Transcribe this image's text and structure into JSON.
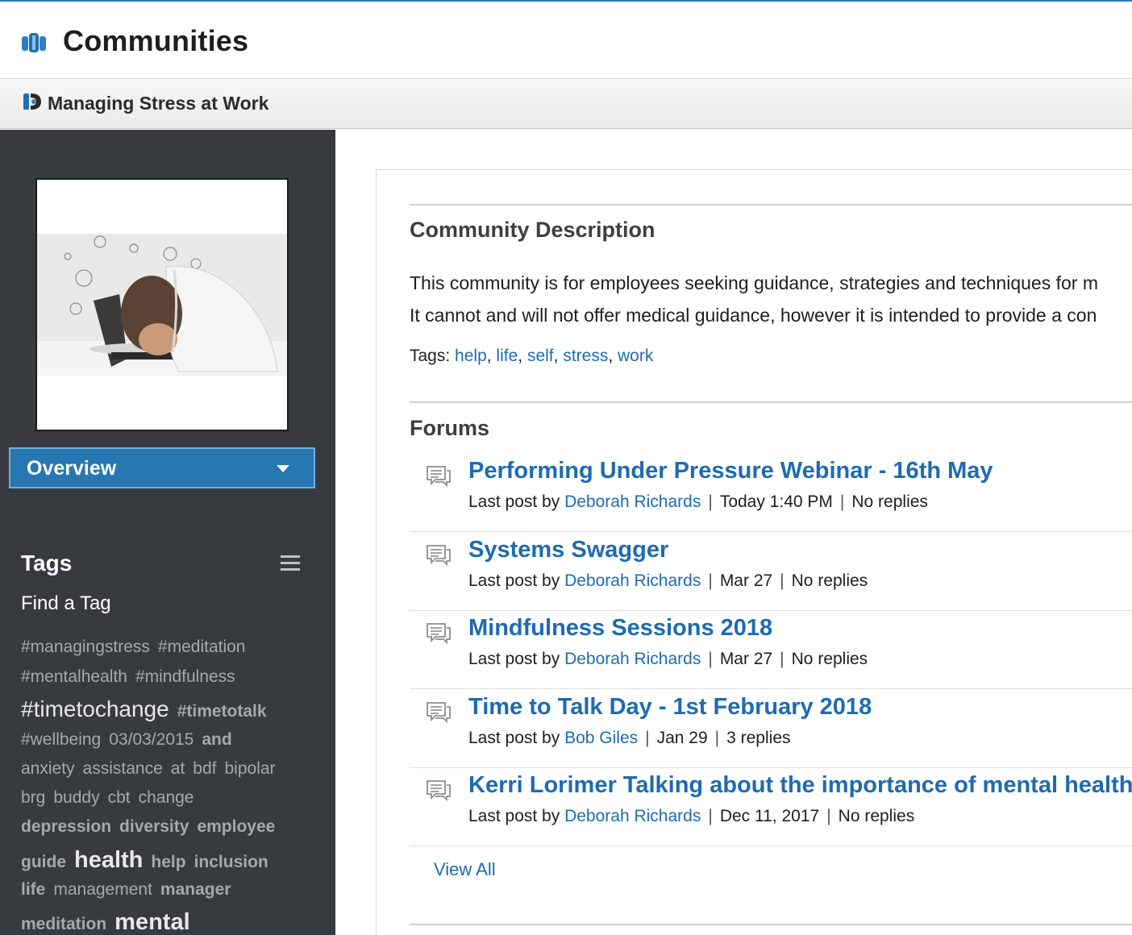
{
  "header": {
    "app_title": "Communities"
  },
  "community": {
    "name": "Managing Stress at Work"
  },
  "sidebar": {
    "nav_selected": "Overview",
    "tags_heading": "Tags",
    "find_tag": "Find a Tag",
    "tag_lines": [
      [
        {
          "t": "#managingstress",
          "s": "sm"
        },
        {
          "t": "#meditation",
          "s": "sm"
        }
      ],
      [
        {
          "t": "#mentalhealth",
          "s": "sm"
        },
        {
          "t": "#mindfulness",
          "s": "sm"
        }
      ],
      [
        {
          "t": "#timetochange",
          "s": "lg"
        },
        {
          "t": "#timetotalk",
          "s": "md"
        }
      ],
      [
        {
          "t": "#wellbeing",
          "s": "sm"
        },
        {
          "t": "03/03/2015",
          "s": "sm"
        },
        {
          "t": "and",
          "s": "md"
        }
      ],
      [
        {
          "t": "anxiety",
          "s": "sm"
        },
        {
          "t": "assistance",
          "s": "sm"
        },
        {
          "t": "at",
          "s": "sm"
        },
        {
          "t": "bdf",
          "s": "sm"
        },
        {
          "t": "bipolar",
          "s": "sm"
        }
      ],
      [
        {
          "t": "brg",
          "s": "sm"
        },
        {
          "t": "buddy",
          "s": "sm"
        },
        {
          "t": "cbt",
          "s": "sm"
        },
        {
          "t": "change",
          "s": "sm"
        }
      ],
      [
        {
          "t": "depression",
          "s": "md"
        },
        {
          "t": "diversity",
          "s": "md"
        },
        {
          "t": "employee",
          "s": "md"
        }
      ],
      [
        {
          "t": "guide",
          "s": "md"
        },
        {
          "t": "health",
          "s": "xl"
        },
        {
          "t": "help",
          "s": "md"
        },
        {
          "t": "inclusion",
          "s": "md"
        }
      ],
      [
        {
          "t": "life",
          "s": "md"
        },
        {
          "t": "management",
          "s": "sm"
        },
        {
          "t": "manager",
          "s": "md"
        }
      ],
      [
        {
          "t": "meditation",
          "s": "md"
        },
        {
          "t": "mental",
          "s": "xl"
        }
      ]
    ]
  },
  "description": {
    "heading": "Community Description",
    "line1": "This community is for employees seeking guidance, strategies and techniques for m",
    "line2": "It cannot and will not offer medical guidance, however it is intended to provide a con",
    "tags_label": "Tags:",
    "tags": [
      "help",
      "life",
      "self",
      "stress",
      "work"
    ]
  },
  "forums": {
    "heading": "Forums",
    "last_post_label": "Last post by",
    "items": [
      {
        "title": "Performing Under Pressure Webinar - 16th May",
        "author": "Deborah Richards",
        "date": "Today 1:40 PM",
        "replies": "No replies"
      },
      {
        "title": "Systems Swagger",
        "author": "Deborah Richards",
        "date": "Mar 27",
        "replies": "No replies"
      },
      {
        "title": "Mindfulness Sessions 2018",
        "author": "Deborah Richards",
        "date": "Mar 27",
        "replies": "No replies"
      },
      {
        "title": "Time to Talk Day - 1st February 2018",
        "author": "Bob Giles",
        "date": "Jan 29",
        "replies": "3 replies"
      },
      {
        "title": "Kerri Lorimer Talking about the importance of mental health",
        "author": "Deborah Richards",
        "date": "Dec 11, 2017",
        "replies": "No replies"
      }
    ],
    "view_all": "View All"
  },
  "colors": {
    "accent": "#2677b2",
    "link": "#1e6bb0",
    "sidebar_bg": "#373b40"
  }
}
